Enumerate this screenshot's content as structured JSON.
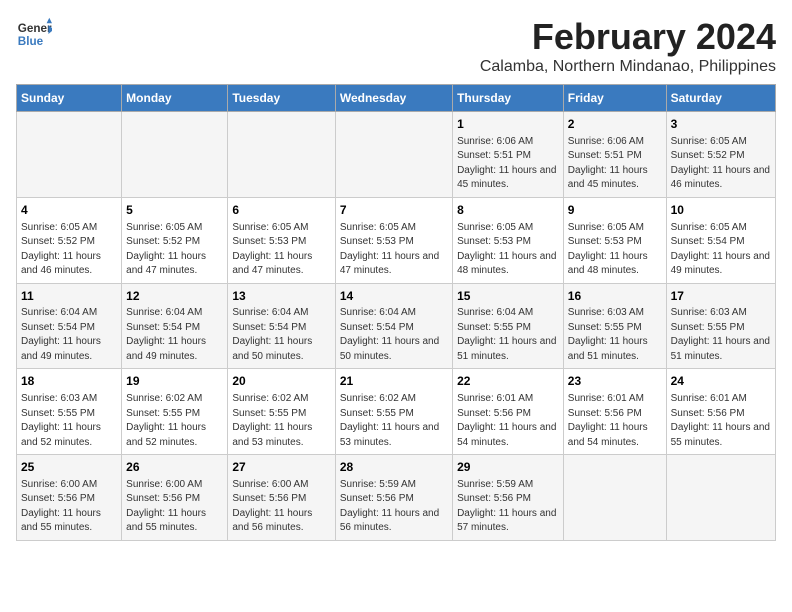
{
  "header": {
    "logo_line1": "General",
    "logo_line2": "Blue",
    "title": "February 2024",
    "subtitle": "Calamba, Northern Mindanao, Philippines"
  },
  "weekdays": [
    "Sunday",
    "Monday",
    "Tuesday",
    "Wednesday",
    "Thursday",
    "Friday",
    "Saturday"
  ],
  "weeks": [
    [
      {
        "day": "",
        "sunrise": "",
        "sunset": "",
        "daylight": ""
      },
      {
        "day": "",
        "sunrise": "",
        "sunset": "",
        "daylight": ""
      },
      {
        "day": "",
        "sunrise": "",
        "sunset": "",
        "daylight": ""
      },
      {
        "day": "",
        "sunrise": "",
        "sunset": "",
        "daylight": ""
      },
      {
        "day": "1",
        "sunrise": "Sunrise: 6:06 AM",
        "sunset": "Sunset: 5:51 PM",
        "daylight": "Daylight: 11 hours and 45 minutes."
      },
      {
        "day": "2",
        "sunrise": "Sunrise: 6:06 AM",
        "sunset": "Sunset: 5:51 PM",
        "daylight": "Daylight: 11 hours and 45 minutes."
      },
      {
        "day": "3",
        "sunrise": "Sunrise: 6:05 AM",
        "sunset": "Sunset: 5:52 PM",
        "daylight": "Daylight: 11 hours and 46 minutes."
      }
    ],
    [
      {
        "day": "4",
        "sunrise": "Sunrise: 6:05 AM",
        "sunset": "Sunset: 5:52 PM",
        "daylight": "Daylight: 11 hours and 46 minutes."
      },
      {
        "day": "5",
        "sunrise": "Sunrise: 6:05 AM",
        "sunset": "Sunset: 5:52 PM",
        "daylight": "Daylight: 11 hours and 47 minutes."
      },
      {
        "day": "6",
        "sunrise": "Sunrise: 6:05 AM",
        "sunset": "Sunset: 5:53 PM",
        "daylight": "Daylight: 11 hours and 47 minutes."
      },
      {
        "day": "7",
        "sunrise": "Sunrise: 6:05 AM",
        "sunset": "Sunset: 5:53 PM",
        "daylight": "Daylight: 11 hours and 47 minutes."
      },
      {
        "day": "8",
        "sunrise": "Sunrise: 6:05 AM",
        "sunset": "Sunset: 5:53 PM",
        "daylight": "Daylight: 11 hours and 48 minutes."
      },
      {
        "day": "9",
        "sunrise": "Sunrise: 6:05 AM",
        "sunset": "Sunset: 5:53 PM",
        "daylight": "Daylight: 11 hours and 48 minutes."
      },
      {
        "day": "10",
        "sunrise": "Sunrise: 6:05 AM",
        "sunset": "Sunset: 5:54 PM",
        "daylight": "Daylight: 11 hours and 49 minutes."
      }
    ],
    [
      {
        "day": "11",
        "sunrise": "Sunrise: 6:04 AM",
        "sunset": "Sunset: 5:54 PM",
        "daylight": "Daylight: 11 hours and 49 minutes."
      },
      {
        "day": "12",
        "sunrise": "Sunrise: 6:04 AM",
        "sunset": "Sunset: 5:54 PM",
        "daylight": "Daylight: 11 hours and 49 minutes."
      },
      {
        "day": "13",
        "sunrise": "Sunrise: 6:04 AM",
        "sunset": "Sunset: 5:54 PM",
        "daylight": "Daylight: 11 hours and 50 minutes."
      },
      {
        "day": "14",
        "sunrise": "Sunrise: 6:04 AM",
        "sunset": "Sunset: 5:54 PM",
        "daylight": "Daylight: 11 hours and 50 minutes."
      },
      {
        "day": "15",
        "sunrise": "Sunrise: 6:04 AM",
        "sunset": "Sunset: 5:55 PM",
        "daylight": "Daylight: 11 hours and 51 minutes."
      },
      {
        "day": "16",
        "sunrise": "Sunrise: 6:03 AM",
        "sunset": "Sunset: 5:55 PM",
        "daylight": "Daylight: 11 hours and 51 minutes."
      },
      {
        "day": "17",
        "sunrise": "Sunrise: 6:03 AM",
        "sunset": "Sunset: 5:55 PM",
        "daylight": "Daylight: 11 hours and 51 minutes."
      }
    ],
    [
      {
        "day": "18",
        "sunrise": "Sunrise: 6:03 AM",
        "sunset": "Sunset: 5:55 PM",
        "daylight": "Daylight: 11 hours and 52 minutes."
      },
      {
        "day": "19",
        "sunrise": "Sunrise: 6:02 AM",
        "sunset": "Sunset: 5:55 PM",
        "daylight": "Daylight: 11 hours and 52 minutes."
      },
      {
        "day": "20",
        "sunrise": "Sunrise: 6:02 AM",
        "sunset": "Sunset: 5:55 PM",
        "daylight": "Daylight: 11 hours and 53 minutes."
      },
      {
        "day": "21",
        "sunrise": "Sunrise: 6:02 AM",
        "sunset": "Sunset: 5:55 PM",
        "daylight": "Daylight: 11 hours and 53 minutes."
      },
      {
        "day": "22",
        "sunrise": "Sunrise: 6:01 AM",
        "sunset": "Sunset: 5:56 PM",
        "daylight": "Daylight: 11 hours and 54 minutes."
      },
      {
        "day": "23",
        "sunrise": "Sunrise: 6:01 AM",
        "sunset": "Sunset: 5:56 PM",
        "daylight": "Daylight: 11 hours and 54 minutes."
      },
      {
        "day": "24",
        "sunrise": "Sunrise: 6:01 AM",
        "sunset": "Sunset: 5:56 PM",
        "daylight": "Daylight: 11 hours and 55 minutes."
      }
    ],
    [
      {
        "day": "25",
        "sunrise": "Sunrise: 6:00 AM",
        "sunset": "Sunset: 5:56 PM",
        "daylight": "Daylight: 11 hours and 55 minutes."
      },
      {
        "day": "26",
        "sunrise": "Sunrise: 6:00 AM",
        "sunset": "Sunset: 5:56 PM",
        "daylight": "Daylight: 11 hours and 55 minutes."
      },
      {
        "day": "27",
        "sunrise": "Sunrise: 6:00 AM",
        "sunset": "Sunset: 5:56 PM",
        "daylight": "Daylight: 11 hours and 56 minutes."
      },
      {
        "day": "28",
        "sunrise": "Sunrise: 5:59 AM",
        "sunset": "Sunset: 5:56 PM",
        "daylight": "Daylight: 11 hours and 56 minutes."
      },
      {
        "day": "29",
        "sunrise": "Sunrise: 5:59 AM",
        "sunset": "Sunset: 5:56 PM",
        "daylight": "Daylight: 11 hours and 57 minutes."
      },
      {
        "day": "",
        "sunrise": "",
        "sunset": "",
        "daylight": ""
      },
      {
        "day": "",
        "sunrise": "",
        "sunset": "",
        "daylight": ""
      }
    ]
  ]
}
